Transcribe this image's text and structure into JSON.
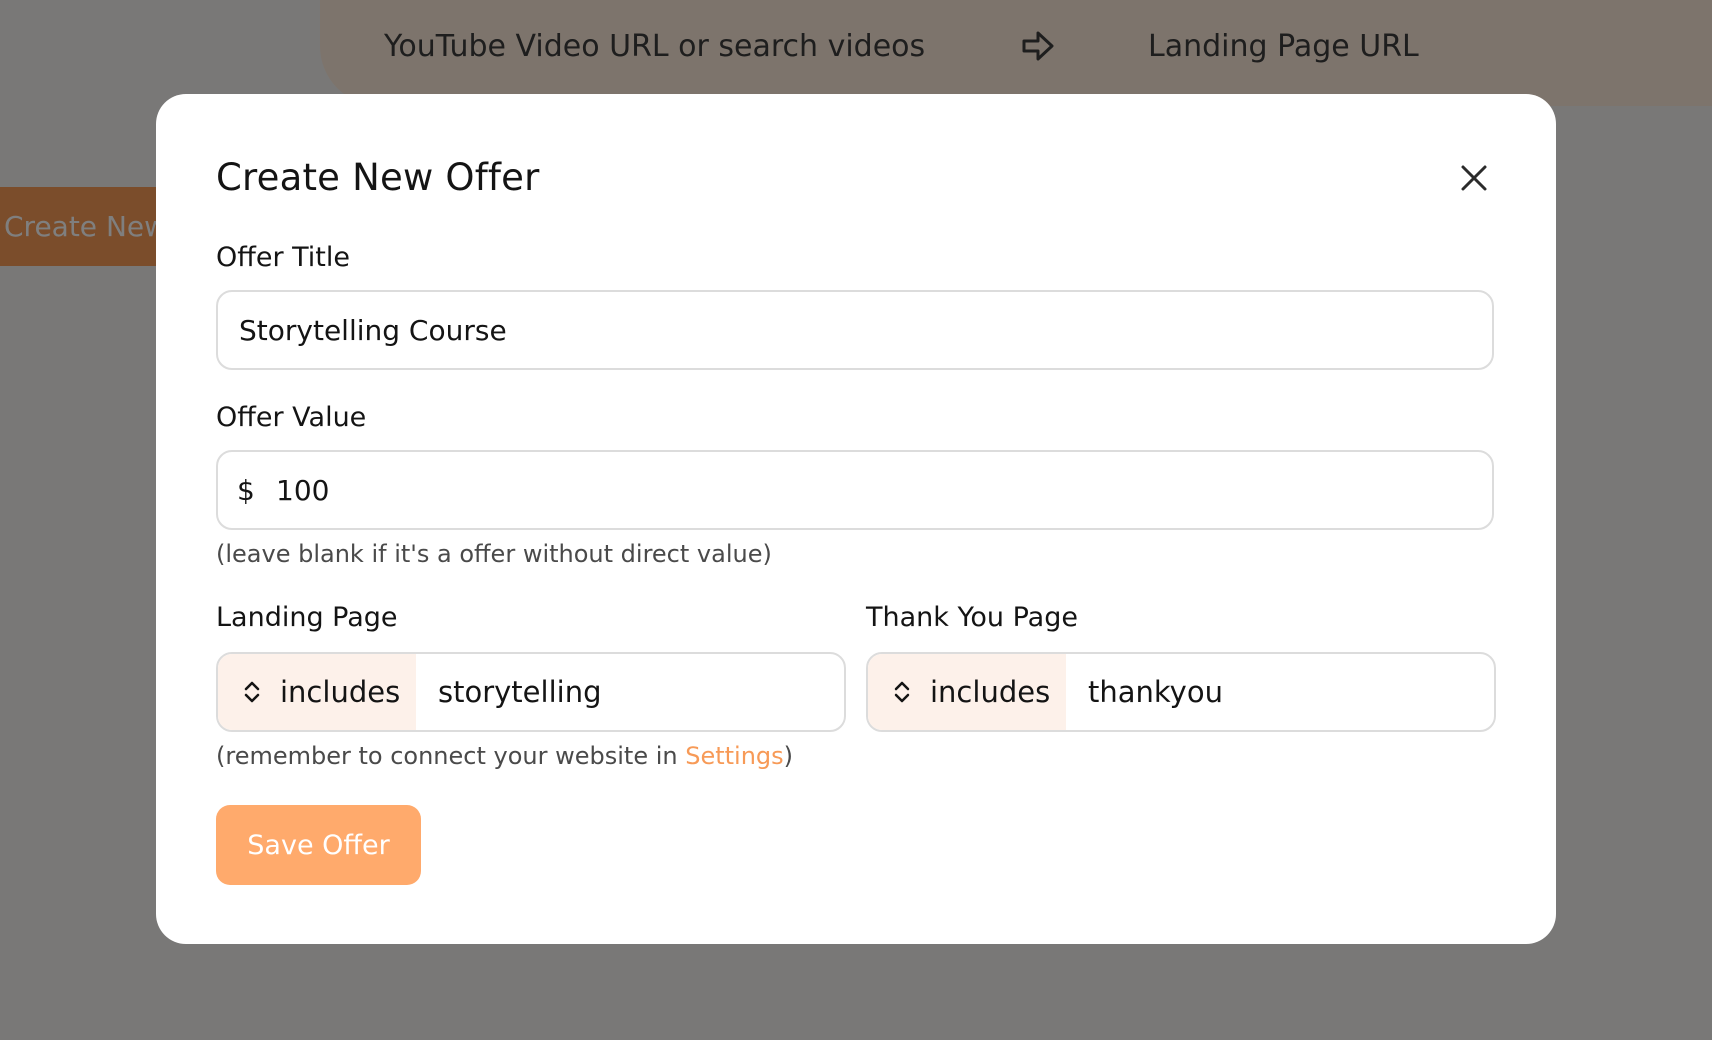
{
  "background": {
    "video_field_placeholder": "YouTube Video URL or search videos",
    "landing_field_placeholder": "Landing Page URL",
    "create_button_label": "Create New"
  },
  "modal": {
    "title": "Create New Offer",
    "offer_title": {
      "label": "Offer Title",
      "value": "Storytelling Course"
    },
    "offer_value": {
      "label": "Offer Value",
      "currency": "$",
      "value": "100",
      "hint": "(leave blank if it's a offer without direct value)"
    },
    "landing_page": {
      "label": "Landing Page",
      "match_type": "includes",
      "value": "storytelling"
    },
    "thank_you_page": {
      "label": "Thank You Page",
      "match_type": "includes",
      "value": "thankyou"
    },
    "connect_hint": {
      "prefix": "(remember to connect your website in ",
      "link": "Settings",
      "suffix": ")"
    },
    "save_label": "Save Offer"
  },
  "colors": {
    "accent": "#ffaa6c",
    "link": "#f79a57",
    "select_bg": "#fdf1ea"
  },
  "icons": {
    "close": "close-icon",
    "arrow": "arrow-right-icon",
    "select": "chevron-up-down-icon"
  }
}
